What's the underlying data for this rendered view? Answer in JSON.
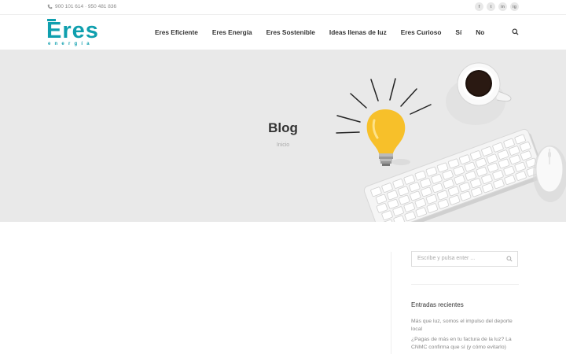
{
  "topbar": {
    "phone": "900 101 614 · 950 481 836",
    "socials": [
      "f",
      "t",
      "in",
      "ig"
    ]
  },
  "logo": {
    "word": "Eres",
    "sub": "energía"
  },
  "nav": [
    "Eres Eficiente",
    "Eres Energía",
    "Eres Sostenible",
    "Ideas llenas de luz",
    "Eres Curioso",
    "Sí",
    "No"
  ],
  "hero": {
    "title": "Blog",
    "breadcrumb": "Inicio"
  },
  "sidebar": {
    "search_placeholder": "Escribe y pulsa enter ...",
    "recent_heading": "Entradas recientes",
    "recent": [
      "Más que luz, somos el impulso del deporte local",
      "¿Pagas de más en tu factura de la luz? La CNMC confirma que sí (y cómo evitarlo)"
    ]
  },
  "colors": {
    "brand": "#0f9fae",
    "hero_bg": "#e9e9e9",
    "bulb": "#f7c02a"
  }
}
